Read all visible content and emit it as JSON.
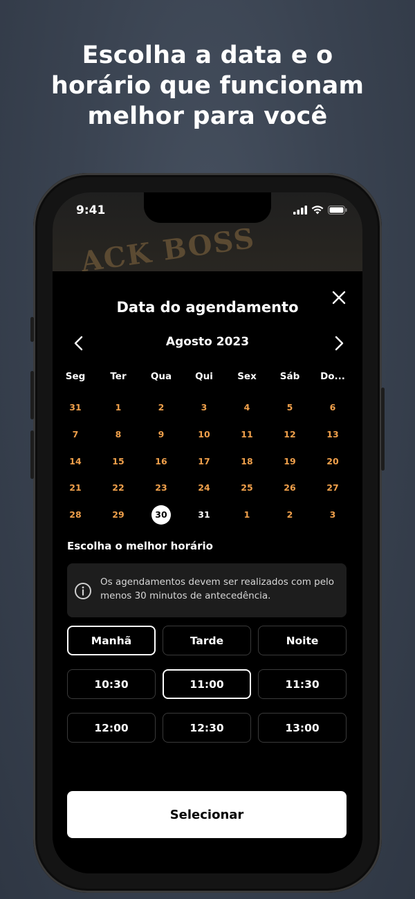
{
  "headline": {
    "line1": "Escolha a data e o",
    "line2": "horário que funcionam",
    "line3": "melhor para você"
  },
  "status_bar": {
    "time": "9:41"
  },
  "background": {
    "sign_text": "ACK BOSS"
  },
  "sheet": {
    "title": "Data do agendamento",
    "close_icon": "close-icon"
  },
  "calendar": {
    "month_label": "Agosto 2023",
    "weekdays": [
      "Seg",
      "Ter",
      "Qua",
      "Qui",
      "Sex",
      "Sáb",
      "Do..."
    ],
    "weeks": [
      [
        "31",
        "1",
        "2",
        "3",
        "4",
        "5",
        "6"
      ],
      [
        "7",
        "8",
        "9",
        "10",
        "11",
        "12",
        "13"
      ],
      [
        "14",
        "15",
        "16",
        "17",
        "18",
        "19",
        "20"
      ],
      [
        "21",
        "22",
        "23",
        "24",
        "25",
        "26",
        "27"
      ],
      [
        "28",
        "29",
        "30",
        "31",
        "1",
        "2",
        "3"
      ]
    ],
    "selected": "30"
  },
  "time_section": {
    "label": "Escolha o melhor horário",
    "info_text": "Os agendamentos devem ser realizados com pelo menos 30 minutos de antecedência.",
    "periods": [
      "Manhã",
      "Tarde",
      "Noite"
    ],
    "active_period": "Manhã",
    "times": [
      [
        "10:30",
        "11:00",
        "11:30"
      ],
      [
        "12:00",
        "12:30",
        "13:00"
      ]
    ],
    "active_time": "11:00"
  },
  "actions": {
    "select_label": "Selecionar"
  },
  "colors": {
    "accent": "#f0a04b",
    "background": "#3a4351",
    "sheet": "#000000"
  }
}
